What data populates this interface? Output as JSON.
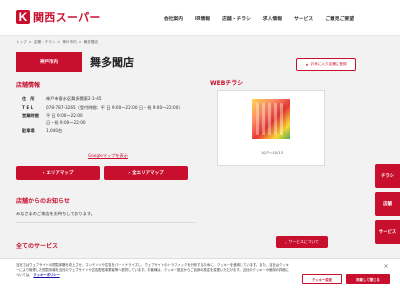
{
  "header": {
    "logo_mark": "K",
    "logo_text": "関西スーパー",
    "nav": [
      "会社案内",
      "IR情報",
      "店舗・チラシ",
      "求人情報",
      "サービス",
      "ご意見ご要望"
    ]
  },
  "breadcrumb": [
    "トップ",
    ">",
    "店舗・チラシ",
    ">",
    "神戸市内",
    ">",
    "舞多聞店"
  ],
  "store": {
    "region": "神戸市内",
    "name": "舞多聞店",
    "favorite_button": "お気に入り店舗に登録"
  },
  "store_info": {
    "title": "店舗情報",
    "rows": [
      {
        "label": "住　所",
        "value": "神戸市垂水区舞多聞東2-1-45"
      },
      {
        "label": "T E L",
        "value": "078-787-3265（受付時間：平 日 9:00～22:00 日・祝 9:00～22:00）"
      },
      {
        "label": "営業時間",
        "value": "平 日 9:00～22:00\n日・祝 9:00～22:00"
      },
      {
        "label": "駐車場",
        "value": "1,040台"
      }
    ],
    "google_map_link": "Googleマップを表示",
    "area_map_button": "エリアマップ",
    "all_area_map_button": "全エリアマップ"
  },
  "notice": {
    "title": "店舗からのお知らせ",
    "text": "みなさまのご来店をお待ちしております。"
  },
  "services": {
    "title": "全てのサービス",
    "button": "サービスについて"
  },
  "web_flyer": {
    "title": "WEBチラシ",
    "date": "10/7〜10/13"
  },
  "side_tabs": [
    "チラシ",
    "店舗",
    "サービス"
  ],
  "cookie": {
    "text": "当社ではウェブサイトの閲覧体験を向上させ、コンテンツや広告をパーソナライズし、ウェブサイトのトラフィックを分析するために、クッキーを使用しています。また、当社はクッキーにより取得した閲覧情報を当社のウェブサイトや広告配信事業者等へ提供しています。お客様は、クッキー設定からご自身の設定を変更いただけます。当社のクッキーの使用の詳細については、",
    "policy_link": "クッキーポリシー",
    "accept_button": "クッキー設定",
    "settings_button": "同意して閉じる",
    "close": "×"
  },
  "colors": {
    "brand": "#c8102e",
    "background": "#f2f2f2"
  }
}
